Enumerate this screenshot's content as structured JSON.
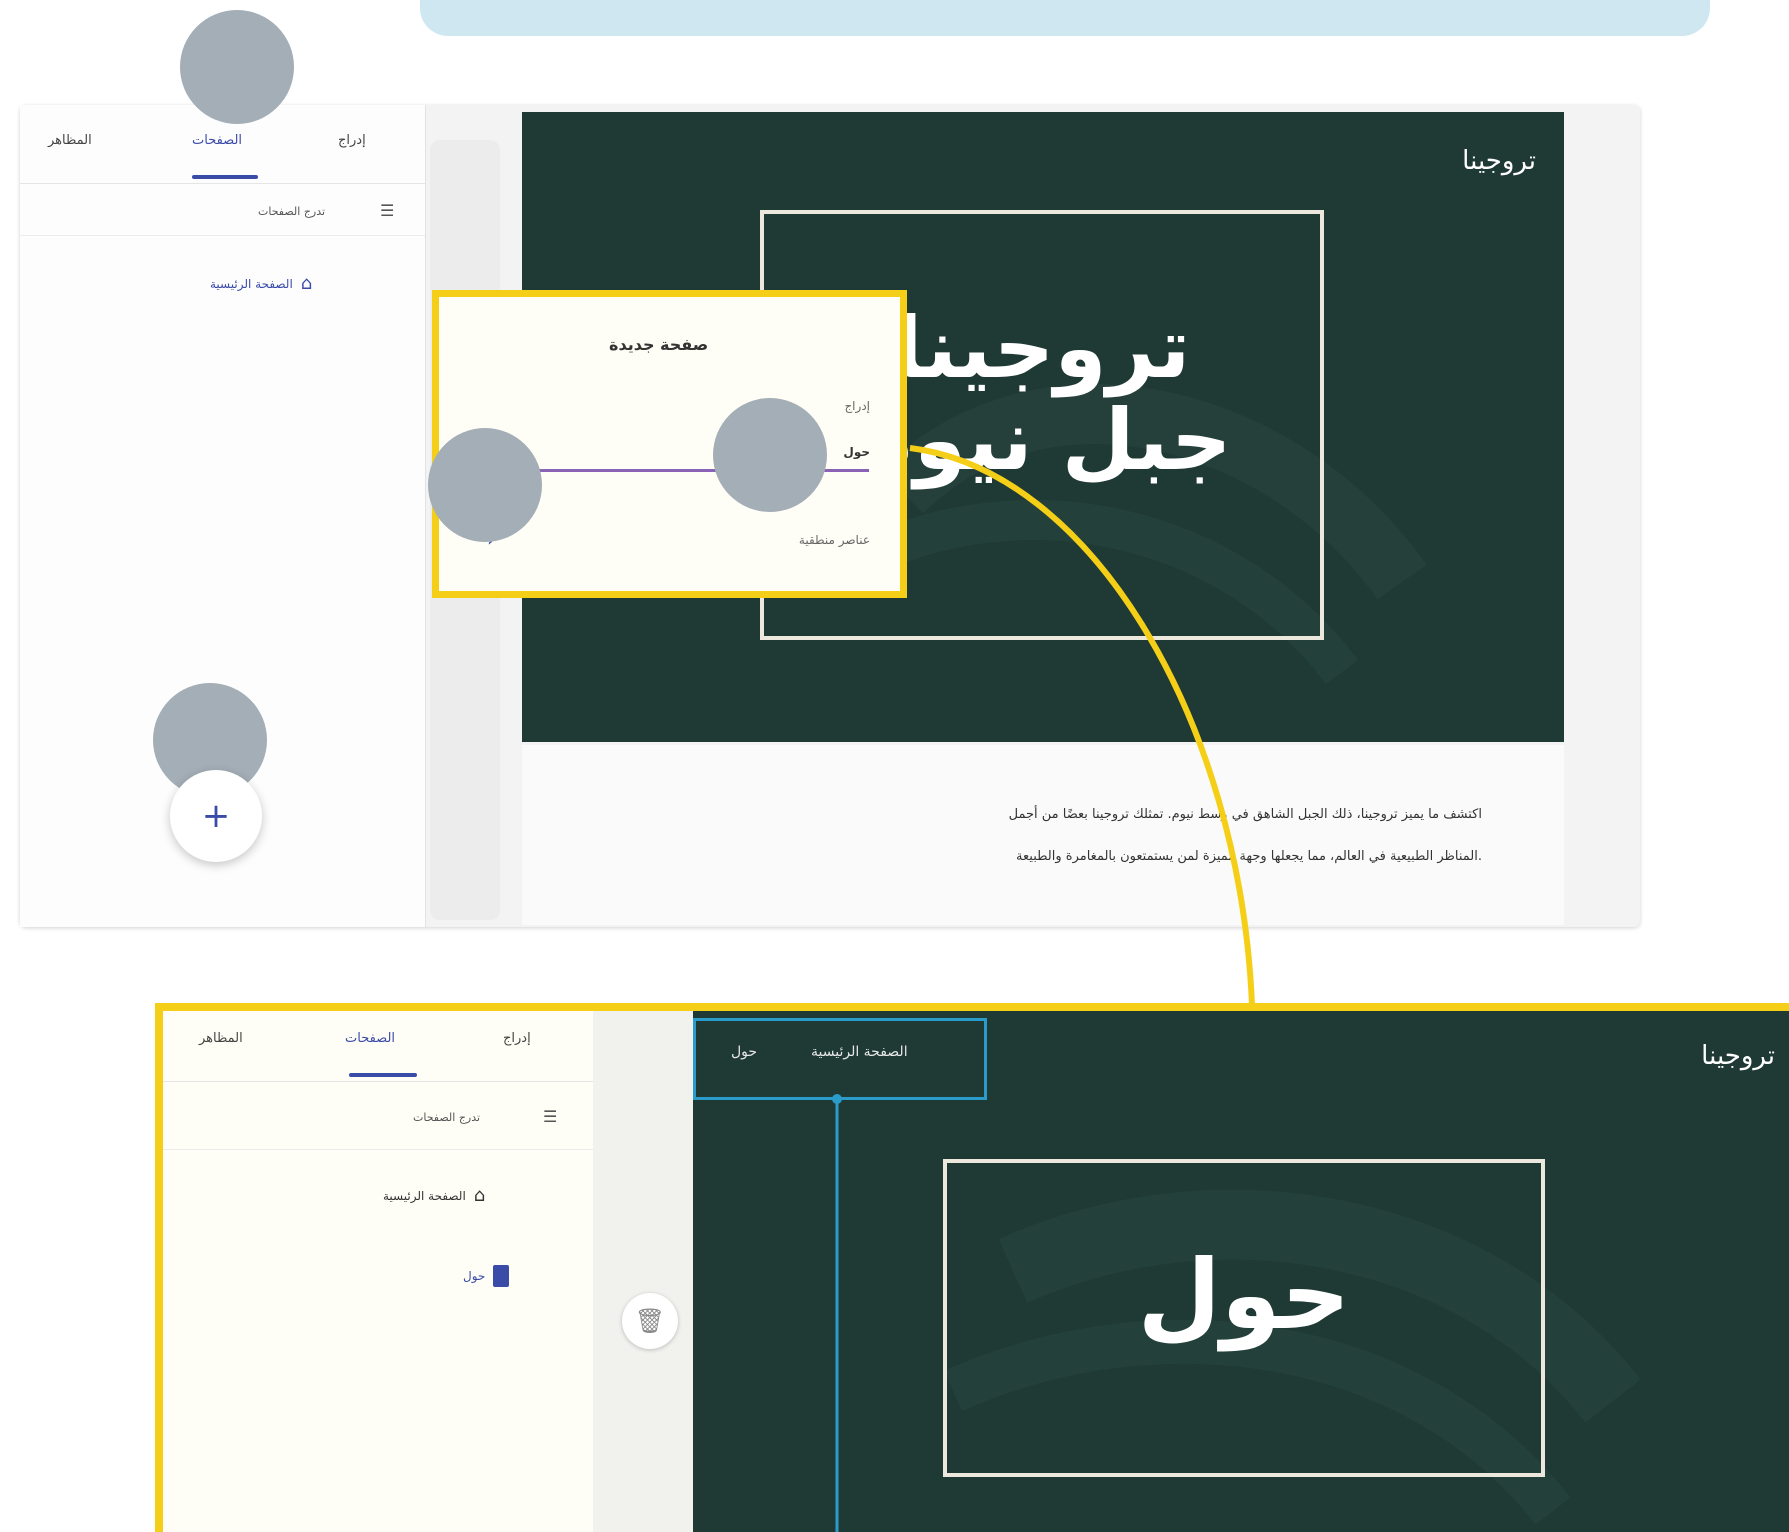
{
  "top_screen": {
    "sidebar": {
      "tabs": [
        {
          "label": "إدراج",
          "active": false
        },
        {
          "label": "الصفحات",
          "active": true
        },
        {
          "label": "المظاهر",
          "active": false
        }
      ],
      "filter_label": "تدرج الصفحات",
      "pages": [
        {
          "label": "الصفحة الرئيسية",
          "icon": "home-icon"
        }
      ]
    },
    "slide": {
      "brand": "تروجينا",
      "title_line1": "تروجينا",
      "title_line2": "جبل نيوم"
    },
    "description": {
      "line1": "اكتشف ما يميز تروجينا، ذلك الجبل الشاهق في وسط نيوم. تمثلك تروجينا بعضًا من أجمل",
      "line2": "المناظر الطبيعية في العالم، مما يجعلها وجهة مميزة لمن يستمتعون بالمغامرة والطبيعة."
    },
    "popup": {
      "title": "صفحة جديدة",
      "options": [
        "إدراج",
        "حول",
        "عناصر منطقية"
      ]
    },
    "fab_label": "+"
  },
  "bottom_screen": {
    "sidebar": {
      "tabs": [
        {
          "label": "إدراج",
          "active": false
        },
        {
          "label": "الصفحات",
          "active": true
        },
        {
          "label": "المظاهر",
          "active": false
        }
      ],
      "filter_label": "تدرج الصفحات",
      "pages": [
        {
          "label": "الصفحة الرئيسية",
          "icon": "home-icon"
        },
        {
          "label": "حول",
          "icon": "page-icon"
        }
      ]
    },
    "slide": {
      "brand": "تروجينا",
      "nav": [
        "الصفحة الرئيسية",
        "حول"
      ],
      "title": "حول"
    },
    "trash_icon": "trash-icon"
  },
  "colors": {
    "highlight": "#f5cf17",
    "accent": "#3b4ba8",
    "callout": "#2b9bc9",
    "slide_bg": "#1f3a34",
    "topbar": "#cfe7f1",
    "placeholder_circle": "#a4aeb7"
  }
}
